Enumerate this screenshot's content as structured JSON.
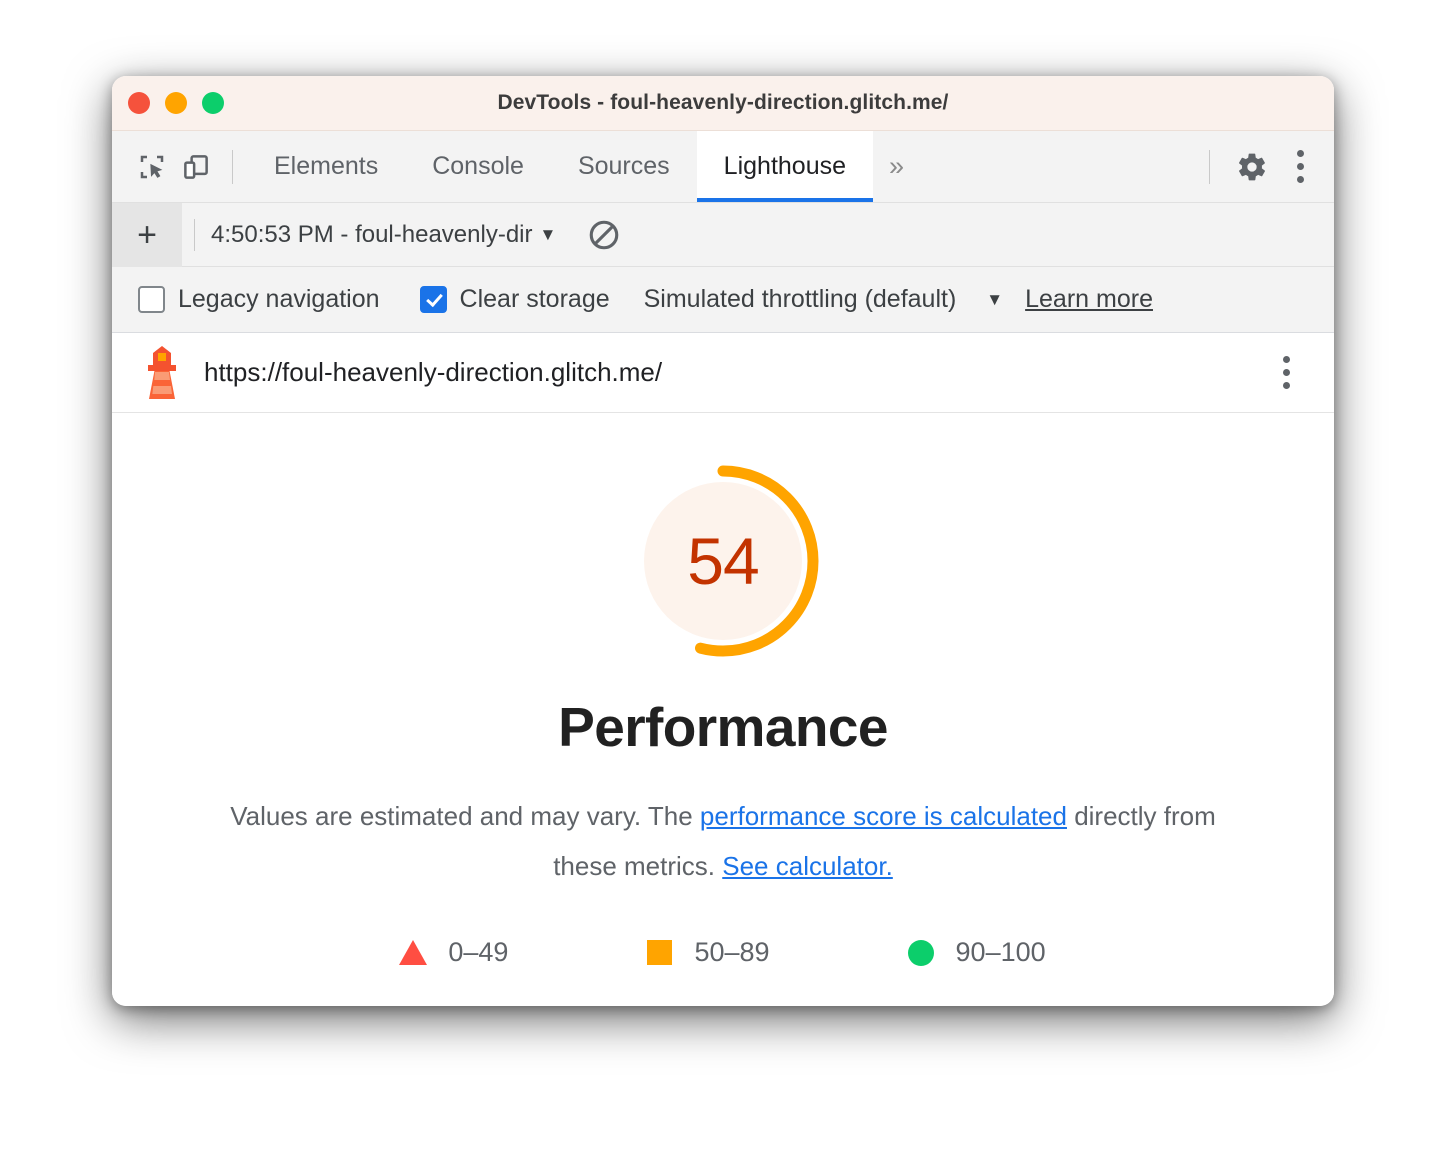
{
  "window": {
    "title": "DevTools - foul-heavenly-direction.glitch.me/",
    "traffic_lights": [
      "close",
      "minimize",
      "maximize"
    ]
  },
  "tabstrip": {
    "inspect_icon": "inspect-element-icon",
    "device_icon": "device-toolbar-icon",
    "tabs": [
      {
        "label": "Elements",
        "active": false
      },
      {
        "label": "Console",
        "active": false
      },
      {
        "label": "Sources",
        "active": false
      },
      {
        "label": "Lighthouse",
        "active": true
      }
    ],
    "more_tabs": "»",
    "settings_icon": "gear-icon",
    "menu_icon": "kebab-menu-icon",
    "active_tab_underline_color": "#1a73e8"
  },
  "run_toolbar": {
    "add_label": "+",
    "run_selected": "4:50:53 PM - foul-heavenly-dir",
    "dropdown_caret": "▼",
    "clear_icon": "no-entry-clear-icon"
  },
  "options": {
    "legacy_navigation": {
      "label": "Legacy navigation",
      "checked": false
    },
    "clear_storage": {
      "label": "Clear storage",
      "checked": true
    },
    "throttling": {
      "label": "Simulated throttling (default)",
      "caret": "▼"
    },
    "learn_more": "Learn more"
  },
  "url_bar": {
    "logo_icon": "lighthouse-logo-icon",
    "url": "https://foul-heavenly-direction.glitch.me/",
    "menu_icon": "kebab-menu-icon"
  },
  "report": {
    "category": "Performance",
    "disclaimer_before": "Values are estimated and may vary. The ",
    "disclaimer_link1": "performance score is calculated",
    "disclaimer_middle": " directly from these metrics. ",
    "disclaimer_link2": "See calculator.",
    "legend": [
      {
        "marker": "triangle",
        "color": "#ff4e42",
        "range": "0–49"
      },
      {
        "marker": "square",
        "color": "#ffa400",
        "range": "50–89"
      },
      {
        "marker": "circle",
        "color": "#0cce6b",
        "range": "90–100"
      }
    ]
  },
  "chart_data": {
    "type": "gauge",
    "title": "Performance",
    "score": 54,
    "score_label": "54",
    "min": 0,
    "max": 100,
    "arc_color": "#ffa400",
    "track_color": "#fdf3ec",
    "score_text_color": "#c33300",
    "rating": "average",
    "thresholds": [
      {
        "label": "0–49",
        "min": 0,
        "max": 49,
        "color": "#ff4e42",
        "shape": "triangle"
      },
      {
        "label": "50–89",
        "min": 50,
        "max": 89,
        "color": "#ffa400",
        "shape": "square"
      },
      {
        "label": "90–100",
        "min": 90,
        "max": 100,
        "color": "#0cce6b",
        "shape": "circle"
      }
    ]
  }
}
